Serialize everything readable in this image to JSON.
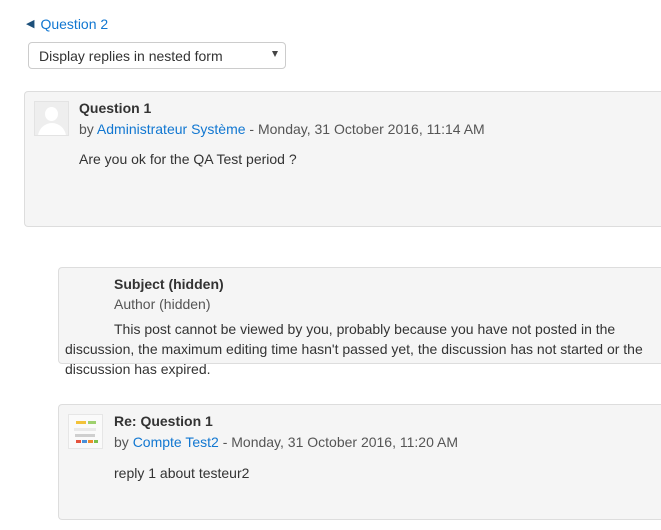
{
  "navigation": {
    "prev_discussion_label": "Question 2"
  },
  "display_mode": {
    "selected": "Display replies in nested form"
  },
  "posts": [
    {
      "subject": "Question 1",
      "by_prefix": "by",
      "author": "Administrateur Système",
      "date": "- Monday, 31 October 2016, 11:14 AM",
      "message": "Are you ok for the QA Test period ?"
    },
    {
      "subject": "Subject (hidden)",
      "author_hidden": "Author (hidden)",
      "message": "This post cannot be viewed by you, probably because you have not posted in the discussion, the maximum editing time hasn't passed yet, the discussion has not started or the discussion has expired."
    },
    {
      "subject": "Re: Question 1",
      "by_prefix": "by",
      "author": "Compte Test2",
      "date": "- Monday, 31 October 2016, 11:20 AM",
      "message": "reply 1 about testeur2"
    }
  ]
}
